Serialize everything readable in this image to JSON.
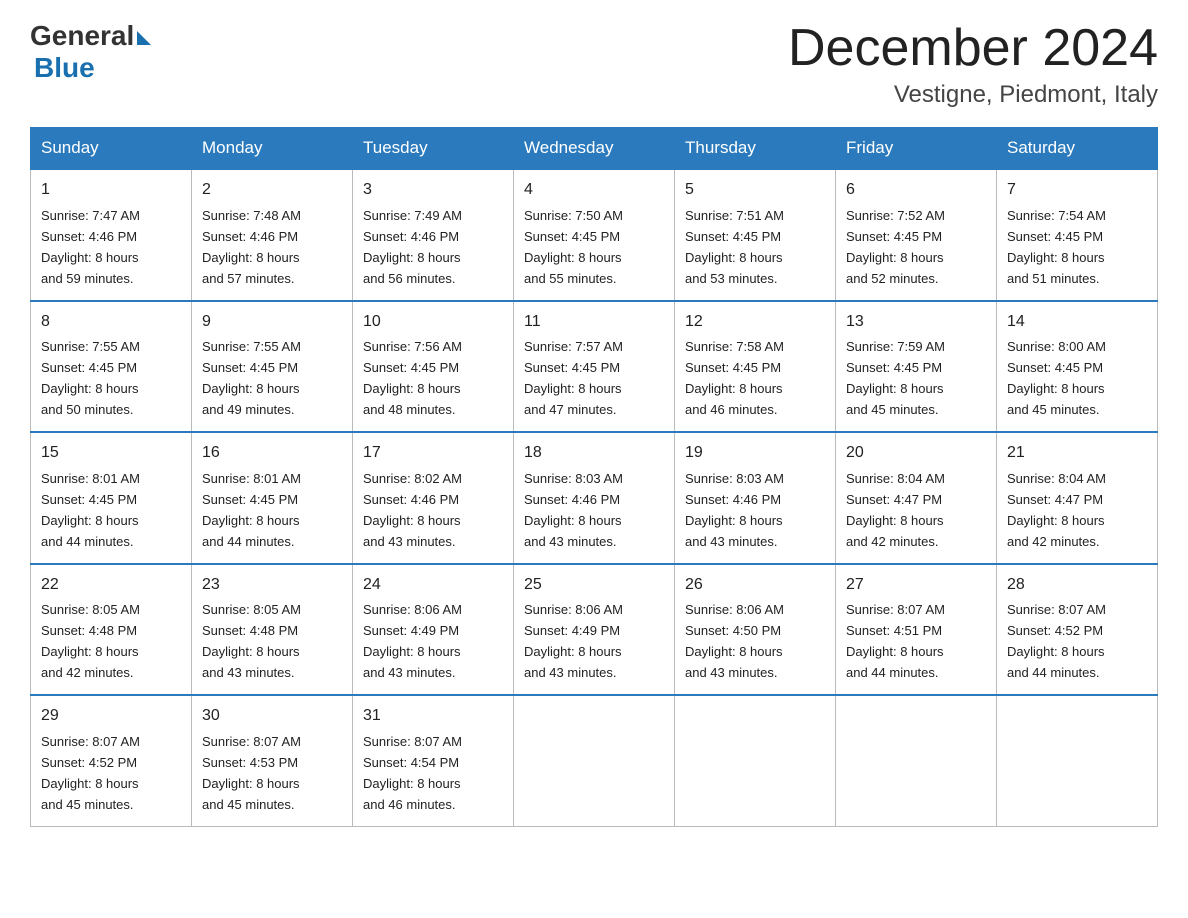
{
  "logo": {
    "text_general": "General",
    "text_blue": "Blue"
  },
  "title": "December 2024",
  "subtitle": "Vestigne, Piedmont, Italy",
  "days_of_week": [
    "Sunday",
    "Monday",
    "Tuesday",
    "Wednesday",
    "Thursday",
    "Friday",
    "Saturday"
  ],
  "weeks": [
    [
      {
        "day": "1",
        "sunrise": "7:47 AM",
        "sunset": "4:46 PM",
        "daylight": "8 hours and 59 minutes."
      },
      {
        "day": "2",
        "sunrise": "7:48 AM",
        "sunset": "4:46 PM",
        "daylight": "8 hours and 57 minutes."
      },
      {
        "day": "3",
        "sunrise": "7:49 AM",
        "sunset": "4:46 PM",
        "daylight": "8 hours and 56 minutes."
      },
      {
        "day": "4",
        "sunrise": "7:50 AM",
        "sunset": "4:45 PM",
        "daylight": "8 hours and 55 minutes."
      },
      {
        "day": "5",
        "sunrise": "7:51 AM",
        "sunset": "4:45 PM",
        "daylight": "8 hours and 53 minutes."
      },
      {
        "day": "6",
        "sunrise": "7:52 AM",
        "sunset": "4:45 PM",
        "daylight": "8 hours and 52 minutes."
      },
      {
        "day": "7",
        "sunrise": "7:54 AM",
        "sunset": "4:45 PM",
        "daylight": "8 hours and 51 minutes."
      }
    ],
    [
      {
        "day": "8",
        "sunrise": "7:55 AM",
        "sunset": "4:45 PM",
        "daylight": "8 hours and 50 minutes."
      },
      {
        "day": "9",
        "sunrise": "7:55 AM",
        "sunset": "4:45 PM",
        "daylight": "8 hours and 49 minutes."
      },
      {
        "day": "10",
        "sunrise": "7:56 AM",
        "sunset": "4:45 PM",
        "daylight": "8 hours and 48 minutes."
      },
      {
        "day": "11",
        "sunrise": "7:57 AM",
        "sunset": "4:45 PM",
        "daylight": "8 hours and 47 minutes."
      },
      {
        "day": "12",
        "sunrise": "7:58 AM",
        "sunset": "4:45 PM",
        "daylight": "8 hours and 46 minutes."
      },
      {
        "day": "13",
        "sunrise": "7:59 AM",
        "sunset": "4:45 PM",
        "daylight": "8 hours and 45 minutes."
      },
      {
        "day": "14",
        "sunrise": "8:00 AM",
        "sunset": "4:45 PM",
        "daylight": "8 hours and 45 minutes."
      }
    ],
    [
      {
        "day": "15",
        "sunrise": "8:01 AM",
        "sunset": "4:45 PM",
        "daylight": "8 hours and 44 minutes."
      },
      {
        "day": "16",
        "sunrise": "8:01 AM",
        "sunset": "4:45 PM",
        "daylight": "8 hours and 44 minutes."
      },
      {
        "day": "17",
        "sunrise": "8:02 AM",
        "sunset": "4:46 PM",
        "daylight": "8 hours and 43 minutes."
      },
      {
        "day": "18",
        "sunrise": "8:03 AM",
        "sunset": "4:46 PM",
        "daylight": "8 hours and 43 minutes."
      },
      {
        "day": "19",
        "sunrise": "8:03 AM",
        "sunset": "4:46 PM",
        "daylight": "8 hours and 43 minutes."
      },
      {
        "day": "20",
        "sunrise": "8:04 AM",
        "sunset": "4:47 PM",
        "daylight": "8 hours and 42 minutes."
      },
      {
        "day": "21",
        "sunrise": "8:04 AM",
        "sunset": "4:47 PM",
        "daylight": "8 hours and 42 minutes."
      }
    ],
    [
      {
        "day": "22",
        "sunrise": "8:05 AM",
        "sunset": "4:48 PM",
        "daylight": "8 hours and 42 minutes."
      },
      {
        "day": "23",
        "sunrise": "8:05 AM",
        "sunset": "4:48 PM",
        "daylight": "8 hours and 43 minutes."
      },
      {
        "day": "24",
        "sunrise": "8:06 AM",
        "sunset": "4:49 PM",
        "daylight": "8 hours and 43 minutes."
      },
      {
        "day": "25",
        "sunrise": "8:06 AM",
        "sunset": "4:49 PM",
        "daylight": "8 hours and 43 minutes."
      },
      {
        "day": "26",
        "sunrise": "8:06 AM",
        "sunset": "4:50 PM",
        "daylight": "8 hours and 43 minutes."
      },
      {
        "day": "27",
        "sunrise": "8:07 AM",
        "sunset": "4:51 PM",
        "daylight": "8 hours and 44 minutes."
      },
      {
        "day": "28",
        "sunrise": "8:07 AM",
        "sunset": "4:52 PM",
        "daylight": "8 hours and 44 minutes."
      }
    ],
    [
      {
        "day": "29",
        "sunrise": "8:07 AM",
        "sunset": "4:52 PM",
        "daylight": "8 hours and 45 minutes."
      },
      {
        "day": "30",
        "sunrise": "8:07 AM",
        "sunset": "4:53 PM",
        "daylight": "8 hours and 45 minutes."
      },
      {
        "day": "31",
        "sunrise": "8:07 AM",
        "sunset": "4:54 PM",
        "daylight": "8 hours and 46 minutes."
      },
      null,
      null,
      null,
      null
    ]
  ],
  "labels": {
    "sunrise": "Sunrise:",
    "sunset": "Sunset:",
    "daylight": "Daylight:"
  }
}
